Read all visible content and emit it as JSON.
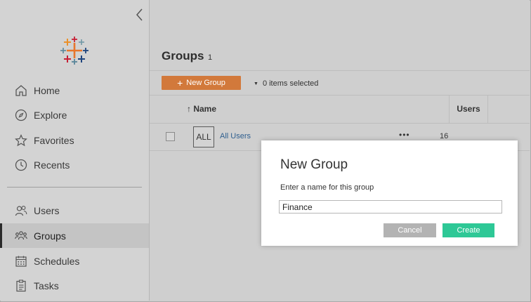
{
  "sidebar": {
    "collapse_icon": "chevron-left-icon",
    "logo_icon": "tableau-logo-icon",
    "items": [
      {
        "label": "Home",
        "icon": "home-icon"
      },
      {
        "label": "Explore",
        "icon": "compass-icon"
      },
      {
        "label": "Favorites",
        "icon": "star-icon"
      },
      {
        "label": "Recents",
        "icon": "clock-icon"
      },
      {
        "label": "Users",
        "icon": "users-icon"
      },
      {
        "label": "Groups",
        "icon": "groups-icon",
        "active": true
      },
      {
        "label": "Schedules",
        "icon": "calendar-icon"
      },
      {
        "label": "Tasks",
        "icon": "clipboard-icon"
      }
    ]
  },
  "main": {
    "title": "Groups",
    "count": "1",
    "toolbar": {
      "new_group_label": "New Group",
      "selection_label": "0 items selected"
    },
    "table": {
      "columns": [
        "Name",
        "Users"
      ],
      "sort_indicator": "↑",
      "rows": [
        {
          "badge": "ALL",
          "name": "All Users",
          "actions": "•••",
          "users": "16"
        }
      ]
    }
  },
  "dialog": {
    "title": "New Group",
    "prompt": "Enter a name for this group",
    "input_value": "Finance",
    "cancel_label": "Cancel",
    "create_label": "Create"
  },
  "colors": {
    "new_group_button": "#d2793b",
    "create_button": "#2ec896",
    "cancel_button": "#b3b3b3",
    "link": "#2f5f8f",
    "overlay_background": "#cfcfcf"
  }
}
